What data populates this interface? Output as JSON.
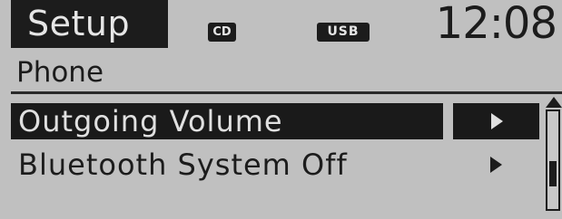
{
  "statusbar": {
    "mode_tab": "Setup",
    "sources": [
      "CD",
      "USB"
    ],
    "clock": "12:08"
  },
  "section": {
    "title": "Phone"
  },
  "menu": {
    "items": [
      {
        "label": "Outgoing Volume",
        "selected": true
      },
      {
        "label": "Bluetooth System Off",
        "selected": false
      }
    ]
  },
  "scrollbar": {
    "position_fraction": 0.7
  },
  "colors": {
    "background": "#c0c0c0",
    "highlight": "#1a1a1a",
    "text_dark": "#1c1c1c",
    "text_light": "#e0e0e0"
  }
}
